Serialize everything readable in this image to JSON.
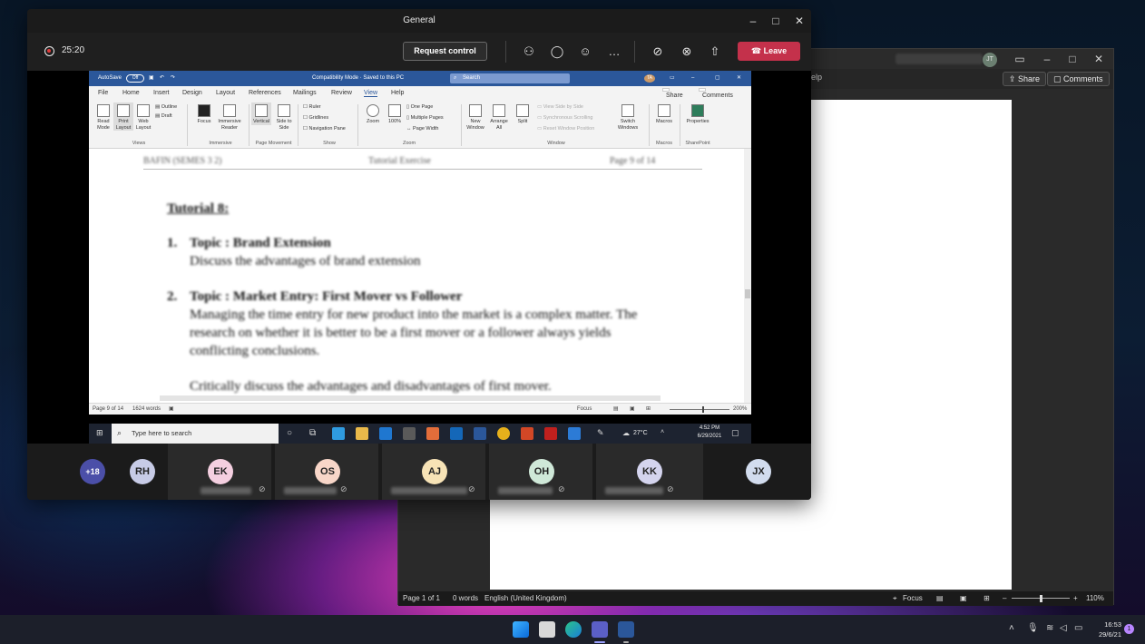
{
  "teams": {
    "window_title": "General",
    "timer": "25:20",
    "request_control_label": "Request control",
    "leave_label": "Leave",
    "more_icon": "…"
  },
  "remote_word": {
    "autosave_label": "AutoSave",
    "autosave_state": "Off",
    "title": "Compatibility Mode · Saved to this PC",
    "search_placeholder": "Search",
    "user_initials": "TA",
    "menu_tabs": [
      "File",
      "Home",
      "Insert",
      "Design",
      "Layout",
      "References",
      "Mailings",
      "Review",
      "View",
      "Help"
    ],
    "active_tab": "View",
    "share_label": "Share",
    "comments_label": "Comments",
    "ribbon": {
      "read_mode": "Read Mode",
      "print_layout": "Print Layout",
      "web_layout": "Web Layout",
      "outline": "Outline",
      "draft": "Draft",
      "group_views": "Views",
      "focus": "Focus",
      "immersive_reader": "Immersive Reader",
      "group_immersive": "Immersive",
      "vertical": "Vertical",
      "side_to_side": "Side to Side",
      "group_page_movement": "Page Movement",
      "ruler": "Ruler",
      "gridlines": "Gridlines",
      "navigation_pane": "Navigation Pane",
      "group_show": "Show",
      "zoom": "Zoom",
      "zoom_100": "100%",
      "one_page": "One Page",
      "multiple_pages": "Multiple Pages",
      "page_width": "Page Width",
      "group_zoom": "Zoom",
      "new_window": "New Window",
      "arrange_all": "Arrange All",
      "split": "Split",
      "view_side_by_side": "View Side by Side",
      "synchronous_scrolling": "Synchronous Scrolling",
      "reset_window_position": "Reset Window Position",
      "switch_windows": "Switch Windows",
      "group_window": "Window",
      "macros": "Macros",
      "group_macros": "Macros",
      "properties": "Properties",
      "group_sharepoint": "SharePoint"
    },
    "doc": {
      "header_left": "BAFIN (SEMES 3 2)",
      "header_mid": "Tutorial Exercise",
      "header_right": "Page 9 of 14",
      "heading": "Tutorial 8:",
      "item1_num": "1.",
      "item1_title": "Topic : Brand Extension",
      "item1_body": "Discuss the advantages of brand extension",
      "item2_num": "2.",
      "item2_title": "Topic : Market Entry: First Mover vs Follower",
      "item2_line1": "Managing the time entry for new product into the market is a complex matter. The",
      "item2_line2": "research on whether it is better to be a first mover or a follower always yields",
      "item2_line3": "conflicting conclusions.",
      "item2_line4": "Critically discuss the advantages and disadvantages of first mover."
    },
    "status_page": "Page 9 of 14",
    "status_words": "1624 words",
    "status_focus": "Focus",
    "status_zoom": "200%",
    "taskbar_search": "Type here to search",
    "weather": "27°C",
    "time": "4:52 PM",
    "date": "6/29/2021"
  },
  "participants": {
    "overflow": "+18",
    "list": [
      {
        "initials": "RH",
        "color": "#c7cbe6"
      },
      {
        "initials": "EK",
        "color": "#f4cfe0"
      },
      {
        "initials": "OS",
        "color": "#f8d6c8"
      },
      {
        "initials": "AJ",
        "color": "#f7e3b6"
      },
      {
        "initials": "OH",
        "color": "#cfe8d8"
      },
      {
        "initials": "KK",
        "color": "#d4d4ee"
      },
      {
        "initials": "JX",
        "color": "#d2dcee"
      }
    ]
  },
  "bg_word": {
    "help_text": "elp",
    "avatar": "JT",
    "share_label": "Share",
    "comments_label": "Comments",
    "status_page": "Page 1 of 1",
    "status_words": "0 words",
    "status_language": "English (United Kingdom)",
    "status_focus": "Focus",
    "status_zoom": "110%"
  },
  "taskbar": {
    "time": "16:53",
    "date": "29/6/21",
    "notification_count": "1"
  },
  "colors": {
    "teams_leave": "#c4314b",
    "word_blue": "#2b579a",
    "win_accent": "#3a8ef6"
  }
}
